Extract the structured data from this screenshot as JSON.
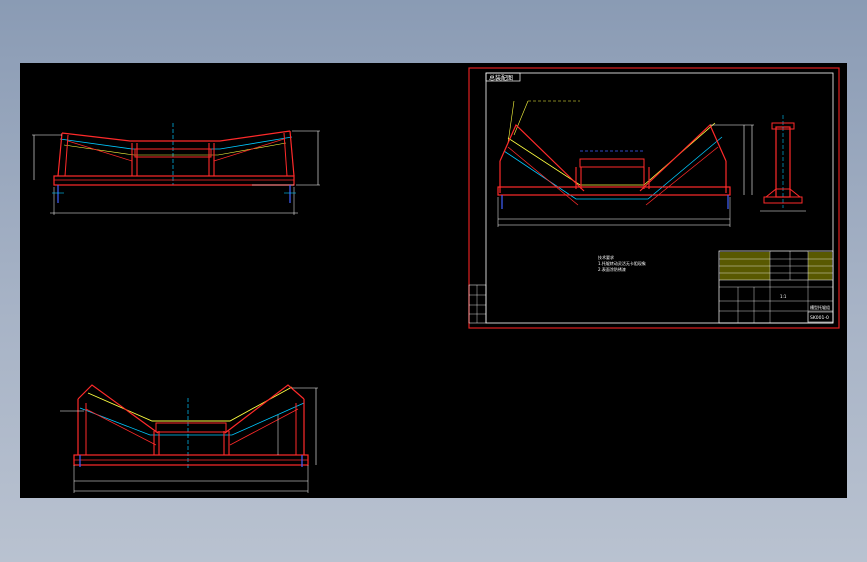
{
  "colors": {
    "background": "#000000",
    "frame": "#e02020",
    "structure": "#ff2a2a",
    "centerline": "#00c8ff",
    "dimension": "#ffffff",
    "highlight": "#ffff40",
    "hidden": "#4060ff",
    "titleblock_cells": "#ffff00"
  },
  "sheet": {
    "header_tab": "总装配图",
    "tech_notes": [
      "技术要求",
      "1.托辊转动灵活无卡阻现象",
      "2.表面涂防锈漆"
    ],
    "title_block": {
      "drawing_name": "槽型托辊组",
      "drawing_number": "SK001-0",
      "scale": "1:1"
    }
  },
  "views": {
    "left_top": {
      "name": "front-view-shallow-trough"
    },
    "left_bottom": {
      "name": "front-view-deep-trough"
    },
    "sheet_main": {
      "name": "sheet-front-view"
    },
    "sheet_side": {
      "name": "sheet-side-view"
    }
  }
}
